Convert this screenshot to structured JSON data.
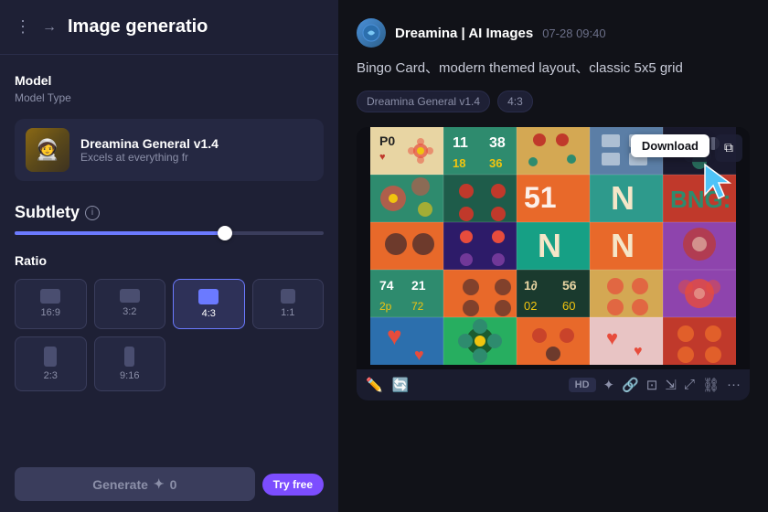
{
  "left_panel": {
    "header": {
      "title": "Image generatio",
      "menu_label": "⋮→"
    },
    "model_section": {
      "label": "Model",
      "sublabel": "Model Type",
      "model_name": "Dreamina General v1.4",
      "model_desc": "Excels at everything fr",
      "model_emoji": "🧑‍🚀"
    },
    "subtlety": {
      "label": "Subtlety",
      "slider_percent": 68
    },
    "ratio": {
      "label": "Ratio",
      "options": [
        {
          "label": "16:9",
          "shape": "landscape",
          "active": false
        },
        {
          "label": "3:2",
          "shape": "landscape-32",
          "active": false
        },
        {
          "label": "4:3",
          "shape": "landscape-43",
          "active": true
        },
        {
          "label": "1:1",
          "shape": "landscape-11",
          "active": false
        },
        {
          "label": "2:3",
          "shape": "portrait-23",
          "active": false
        },
        {
          "label": "9:16",
          "shape": "portrait-916",
          "active": false
        }
      ]
    },
    "generate_btn": "Generate",
    "generate_cost": "0",
    "try_free_label": "Try free"
  },
  "right_panel": {
    "app_name": "Dreamina | AI Images",
    "chat_time": "07-28   09:40",
    "prompt": "Bingo Card、modern themed layout、classic 5x5 grid",
    "tags": [
      "Dreamina General v1.4",
      "4:3"
    ],
    "download_tooltip": "Download",
    "hd_label": "HD"
  }
}
